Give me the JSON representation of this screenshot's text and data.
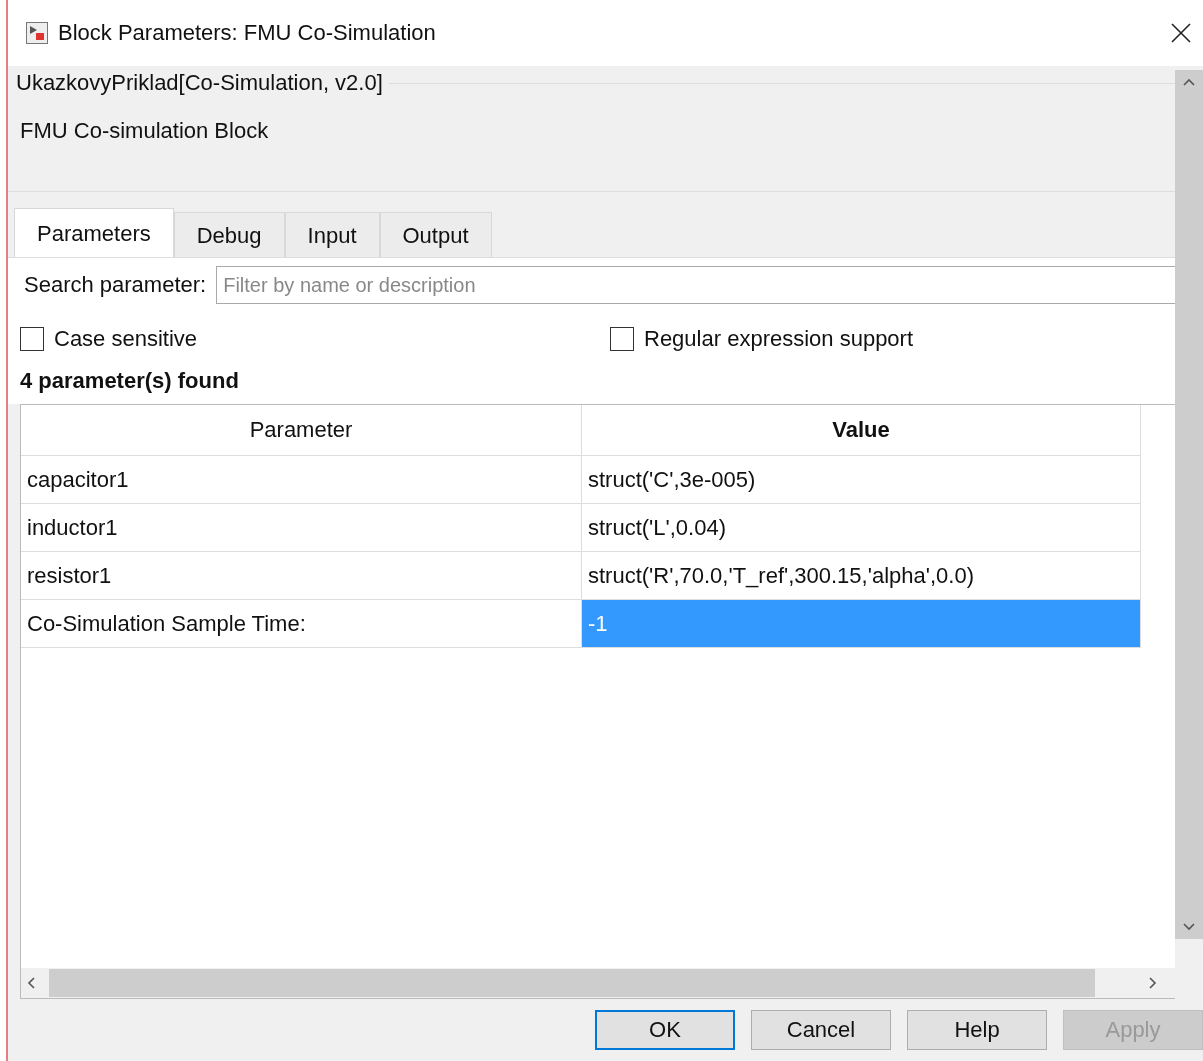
{
  "window": {
    "title": "Block Parameters: FMU Co-Simulation"
  },
  "group": {
    "title": "UkazkovyPriklad[Co-Simulation, v2.0]",
    "description": "FMU Co-simulation Block"
  },
  "tabs": [
    {
      "label": "Parameters",
      "selected": true
    },
    {
      "label": "Debug",
      "selected": false
    },
    {
      "label": "Input",
      "selected": false
    },
    {
      "label": "Output",
      "selected": false
    }
  ],
  "search": {
    "label": "Search parameter:",
    "placeholder": "Filter by name or description"
  },
  "options": [
    {
      "label": "Case sensitive",
      "checked": false
    },
    {
      "label": "Regular expression support",
      "checked": false
    }
  ],
  "found": "4 parameter(s) found",
  "table": {
    "columns": [
      {
        "label": "Parameter",
        "sorted": false
      },
      {
        "label": "Value",
        "sorted": true
      }
    ],
    "rows": [
      {
        "parameter": "capacitor1",
        "value": "struct('C',3e-005)",
        "selected": false
      },
      {
        "parameter": "inductor1",
        "value": "struct('L',0.04)",
        "selected": false
      },
      {
        "parameter": "resistor1",
        "value": "struct('R',70.0,'T_ref',300.15,'alpha',0.0)",
        "selected": false
      },
      {
        "parameter": "Co-Simulation Sample Time:",
        "value": "-1",
        "selected": true
      }
    ]
  },
  "buttons": [
    {
      "label": "OK",
      "default": true,
      "disabled": false
    },
    {
      "label": "Cancel",
      "default": false,
      "disabled": false
    },
    {
      "label": "Help",
      "default": false,
      "disabled": false
    },
    {
      "label": "Apply",
      "default": false,
      "disabled": true
    }
  ]
}
